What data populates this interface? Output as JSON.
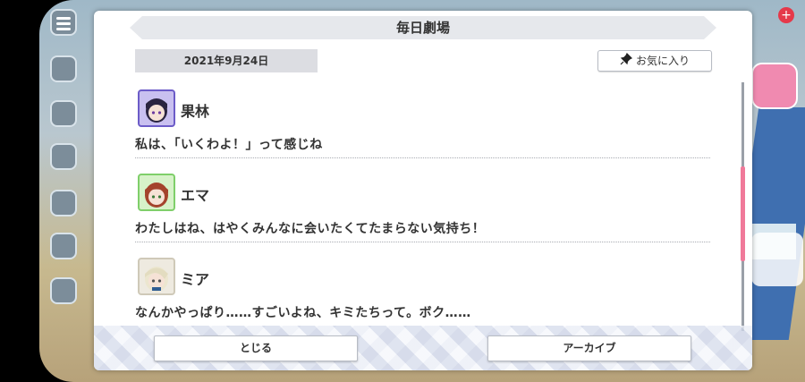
{
  "window": {
    "title": "毎日劇場"
  },
  "header": {
    "date": "2021年9月24日",
    "favorite_label": "お気に入り",
    "favorite_icon": "pin-icon"
  },
  "entries": [
    {
      "name": "果林",
      "message": "私は、「いくわよ！」って感じね",
      "avatar_color": "#6c5cc8"
    },
    {
      "name": "エマ",
      "message": "わたしはね、はやくみんなに会いたくてたまらない気持ち！",
      "avatar_color": "#7fcf6a"
    },
    {
      "name": "ミア",
      "message": "なんかやっぱり……すごいよね、キミたちって。ボク……",
      "avatar_color": "#cfc9b8"
    }
  ],
  "footer": {
    "close_label": "とじる",
    "archive_label": "アーカイブ"
  },
  "background": {
    "badge": "+"
  },
  "colors": {
    "accent": "#f07a9a",
    "title_bar": "#e6e8ec",
    "date_box": "#dcdde2"
  }
}
